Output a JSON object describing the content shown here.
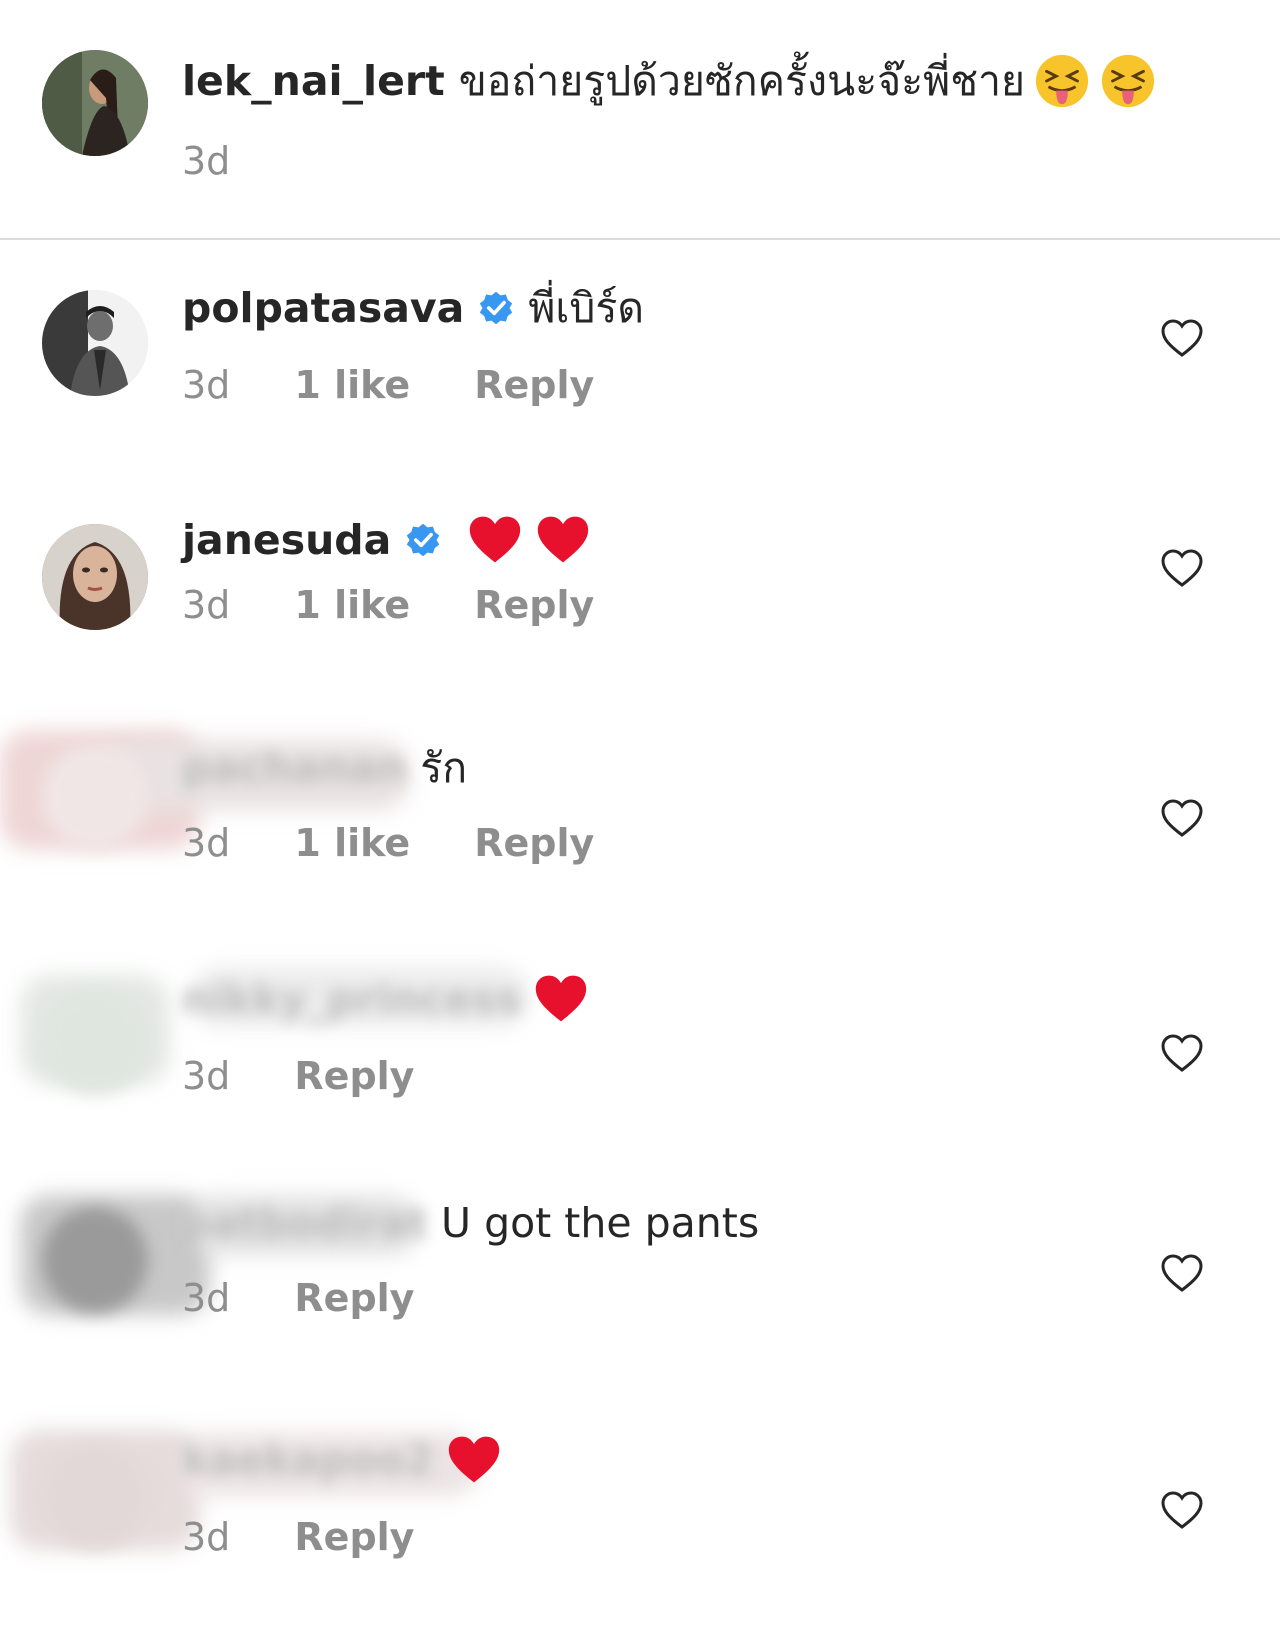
{
  "caption": {
    "username": "lek_nai_lert",
    "text": "ขอถ่ายรูปด้วยซักครั้งนะจ๊ะพี่ชาย",
    "emoji_icons": [
      "squinting-tongue-emoji",
      "squinting-tongue-emoji"
    ],
    "time": "3d"
  },
  "comments": [
    {
      "username": "polpatasava",
      "verified": true,
      "text": "พี่เบิร์ด",
      "time": "3d",
      "likes": "1 like",
      "reply": "Reply"
    },
    {
      "username": "janesuda",
      "verified": true,
      "text": "",
      "emoji_icons": [
        "red-heart-emoji",
        "red-heart-emoji"
      ],
      "time": "3d",
      "likes": "1 like",
      "reply": "Reply"
    },
    {
      "username": "pachanan",
      "username_blurred": true,
      "text": "รัก",
      "time": "3d",
      "likes": "1 like",
      "reply": "Reply"
    },
    {
      "username": "nikky_princess",
      "username_blurred": true,
      "text": "",
      "emoji_icons": [
        "red-heart-emoji"
      ],
      "time": "3d",
      "reply": "Reply"
    },
    {
      "username": "patbodirat",
      "username_blurred": true,
      "text": "U got the pants",
      "time": "3d",
      "reply": "Reply"
    },
    {
      "username": "kaekapoo2",
      "username_blurred": true,
      "text": "",
      "emoji_icons": [
        "red-heart-emoji"
      ],
      "time": "3d",
      "reply": "Reply"
    }
  ],
  "colors": {
    "text": "#262626",
    "meta": "#8e8e8e",
    "verified": "#3897f0",
    "heart": "#e8112d",
    "divider": "#dbdbdb"
  }
}
